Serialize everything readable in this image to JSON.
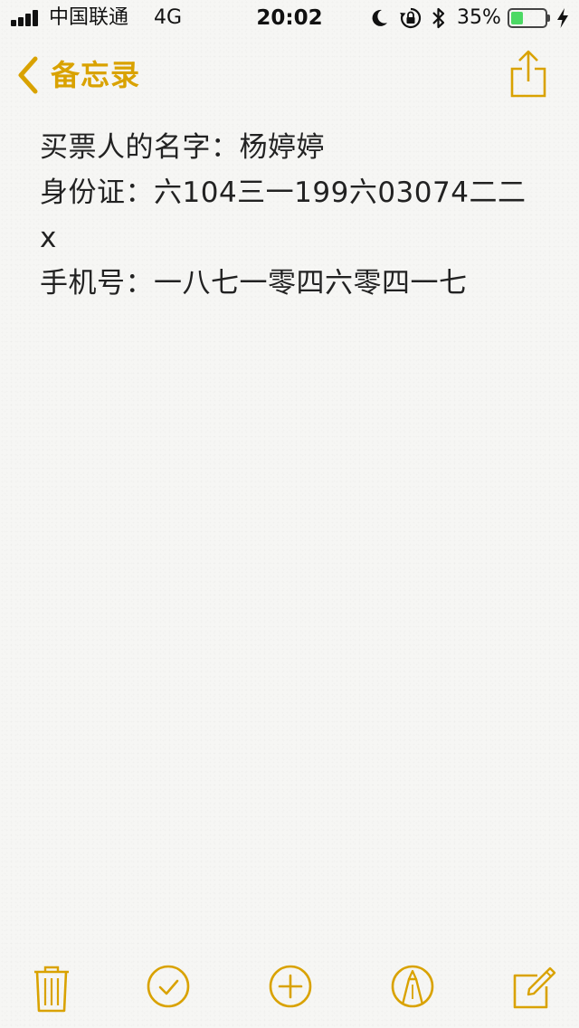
{
  "status_bar": {
    "carrier": "中国联通",
    "network": "4G",
    "time": "20:02",
    "battery_percent_label": "35%",
    "battery_level": 0.35,
    "icons": [
      "signal-icon",
      "moon-icon",
      "rotation-lock-icon",
      "bluetooth-icon",
      "battery-icon",
      "charging-icon"
    ]
  },
  "nav": {
    "back_label": "备忘录",
    "accent_color": "#d9a200"
  },
  "note": {
    "lines": [
      "买票人的名字：杨婷婷",
      "身份证：六104三一199六03074二二x",
      "手机号：一八七一零四六零四一七"
    ]
  },
  "toolbar": {
    "buttons": [
      "trash-icon",
      "checklist-icon",
      "add-icon",
      "markup-icon",
      "compose-icon"
    ]
  }
}
